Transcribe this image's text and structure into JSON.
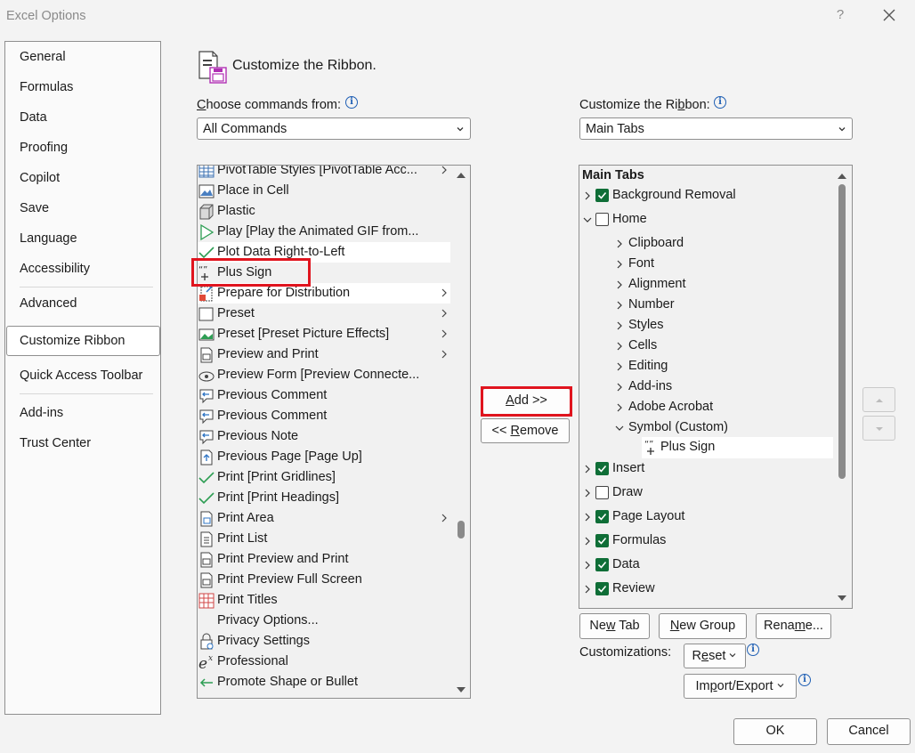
{
  "window": {
    "title": "Excel Options",
    "help": "?"
  },
  "nav": {
    "items": [
      {
        "label": "General"
      },
      {
        "label": "Formulas"
      },
      {
        "label": "Data"
      },
      {
        "label": "Proofing"
      },
      {
        "label": "Copilot"
      },
      {
        "label": "Save"
      },
      {
        "label": "Language"
      },
      {
        "label": "Accessibility"
      },
      {
        "label": "Advanced"
      },
      {
        "label": "Customize Ribbon",
        "selected": true
      },
      {
        "label": "Quick Access Toolbar"
      },
      {
        "label": "Add-ins"
      },
      {
        "label": "Trust Center"
      }
    ]
  },
  "header": {
    "title": "Customize the Ribbon."
  },
  "choose": {
    "label_first": "C",
    "label_rest": "hoose commands from:",
    "value": "All Commands"
  },
  "customize": {
    "label_pre": "Customize the Ri",
    "label_u": "b",
    "label_post": "bon:",
    "value": "Main Tabs"
  },
  "commands": [
    {
      "label": "PivotTable Styles [PivotTable Acc...",
      "icon": "table-grid-icon",
      "submenu": true
    },
    {
      "label": "Place in Cell",
      "icon": "picture-icon"
    },
    {
      "label": "Plastic",
      "icon": "cube-icon"
    },
    {
      "label": "Play [Play the Animated GIF from...",
      "icon": "play-icon"
    },
    {
      "label": "Plot Data Right-to-Left",
      "icon": "check-icon"
    },
    {
      "label": "Plus Sign",
      "icon": "plus-sign-icon"
    },
    {
      "label": "Prepare for Distribution",
      "icon": "prepare-icon",
      "submenu": true
    },
    {
      "label": "Preset",
      "icon": "preset-box-icon",
      "submenu": true
    },
    {
      "label": "Preset [Preset Picture Effects]",
      "icon": "picture-effects-icon",
      "submenu": true
    },
    {
      "label": "Preview and Print",
      "icon": "print-preview-icon",
      "submenu": true
    },
    {
      "label": "Preview Form [Preview Connecte...",
      "icon": "preview-form-icon"
    },
    {
      "label": "Previous Comment",
      "icon": "previous-comment-icon"
    },
    {
      "label": "Previous Comment",
      "icon": "previous-comment-icon"
    },
    {
      "label": "Previous Note",
      "icon": "previous-note-icon"
    },
    {
      "label": "Previous Page [Page Up]",
      "icon": "page-up-icon"
    },
    {
      "label": "Print [Print Gridlines]",
      "icon": "check-icon"
    },
    {
      "label": "Print [Print Headings]",
      "icon": "check-icon"
    },
    {
      "label": "Print Area",
      "icon": "print-area-icon",
      "submenu": true
    },
    {
      "label": "Print List",
      "icon": "print-list-icon"
    },
    {
      "label": "Print Preview and Print",
      "icon": "print-preview-icon"
    },
    {
      "label": "Print Preview Full Screen",
      "icon": "print-preview-icon"
    },
    {
      "label": "Print Titles",
      "icon": "print-titles-icon"
    },
    {
      "label": "Privacy Options...",
      "icon": ""
    },
    {
      "label": "Privacy Settings",
      "icon": "privacy-lock-icon"
    },
    {
      "label": "Professional",
      "icon": "equation-icon"
    },
    {
      "label": "Promote Shape or Bullet",
      "icon": "promote-arrow-icon"
    }
  ],
  "add_button": {
    "u": "A",
    "rest": "dd >>"
  },
  "remove_button": {
    "pre": "<< ",
    "u": "R",
    "rest": "emove"
  },
  "tree": {
    "header": "Main Tabs",
    "rows": [
      {
        "label": "Background Removal",
        "level": 0,
        "expanded": false,
        "checkbox": "on"
      },
      {
        "label": "Home",
        "level": 0,
        "expanded": true,
        "checkbox": "off"
      },
      {
        "label": "Clipboard",
        "level": 1,
        "expanded": false
      },
      {
        "label": "Font",
        "level": 1,
        "expanded": false
      },
      {
        "label": "Alignment",
        "level": 1,
        "expanded": false
      },
      {
        "label": "Number",
        "level": 1,
        "expanded": false
      },
      {
        "label": "Styles",
        "level": 1,
        "expanded": false
      },
      {
        "label": "Cells",
        "level": 1,
        "expanded": false
      },
      {
        "label": "Editing",
        "level": 1,
        "expanded": false
      },
      {
        "label": "Add-ins",
        "level": 1,
        "expanded": false
      },
      {
        "label": "Adobe Acrobat",
        "level": 1,
        "expanded": false
      },
      {
        "label": "Symbol (Custom)",
        "level": 1,
        "expanded": true
      },
      {
        "label": "Plus Sign",
        "level": 2,
        "icon": "plus-sign-icon"
      },
      {
        "label": "Insert",
        "level": 0,
        "expanded": false,
        "checkbox": "on"
      },
      {
        "label": "Draw",
        "level": 0,
        "expanded": false,
        "checkbox": "off"
      },
      {
        "label": "Page Layout",
        "level": 0,
        "expanded": false,
        "checkbox": "on"
      },
      {
        "label": "Formulas",
        "level": 0,
        "expanded": false,
        "checkbox": "on"
      },
      {
        "label": "Data",
        "level": 0,
        "expanded": false,
        "checkbox": "on"
      },
      {
        "label": "Review",
        "level": 0,
        "expanded": false,
        "checkbox": "on"
      }
    ]
  },
  "bottom": {
    "new_tab": {
      "pre": "Ne",
      "u": "w",
      "post": " Tab"
    },
    "new_group": {
      "pre": "",
      "u": "N",
      "post": "ew Group"
    },
    "rename": {
      "pre": "Rena",
      "u": "m",
      "post": "e..."
    },
    "customizations_label": "Customizations:",
    "reset": {
      "pre": "R",
      "u": "e",
      "post": "set"
    },
    "import_export": {
      "pre": "Im",
      "u": "p",
      "post": "ort/Export"
    },
    "ok": "OK",
    "cancel": "Cancel"
  },
  "colors": {
    "accent_check": "#0f6e37",
    "highlight_box": "#e0141e",
    "info_icon": "#1f5fb4"
  }
}
